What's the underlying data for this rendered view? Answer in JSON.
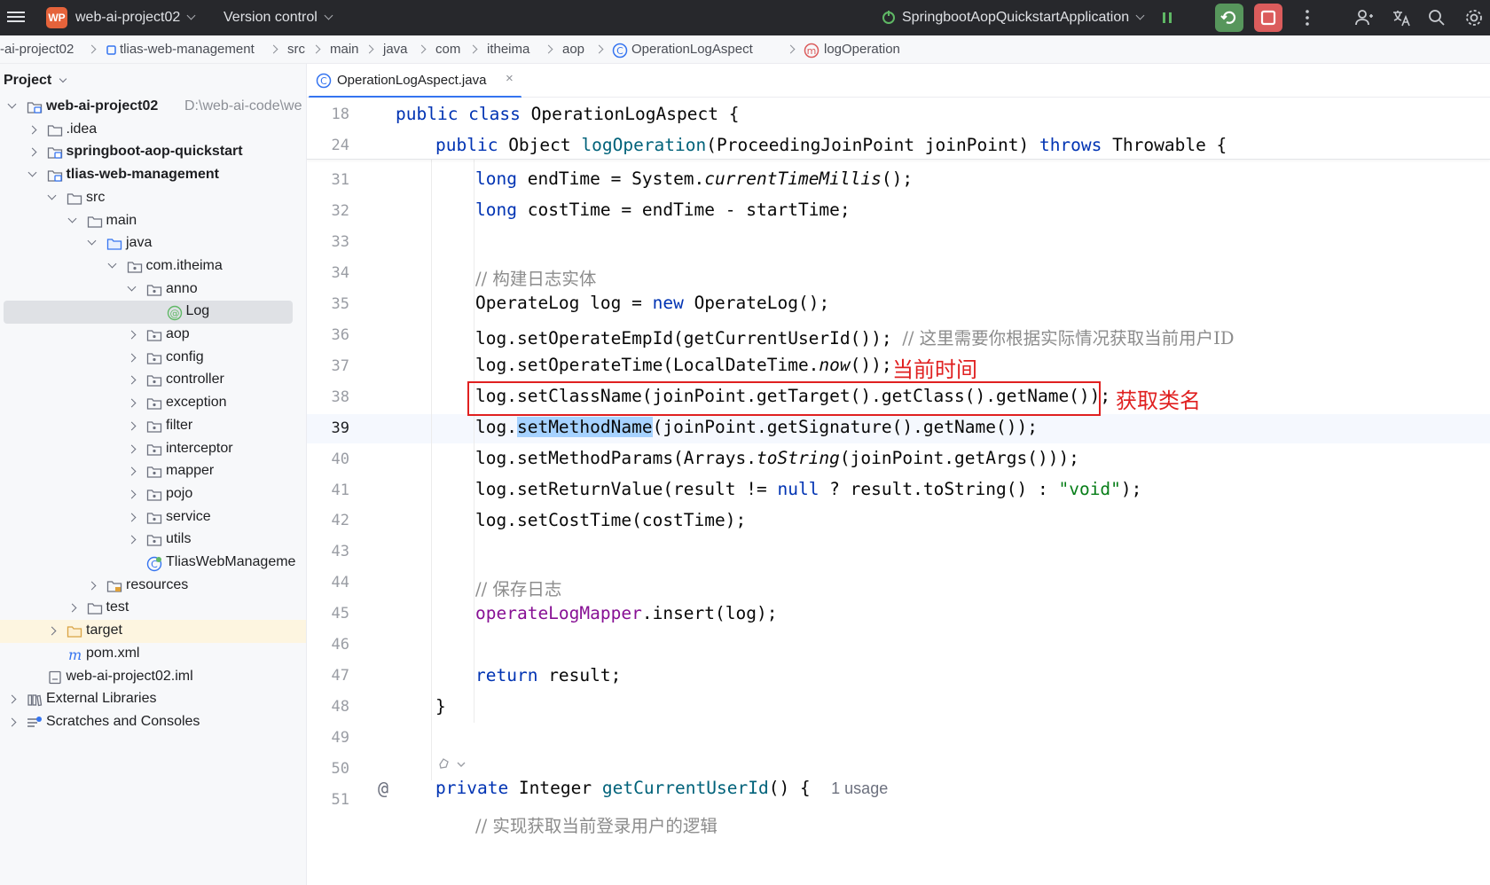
{
  "titlebar": {
    "project_badge": "WP",
    "project_name": "web-ai-project02",
    "vcs_label": "Version control",
    "run_config": "SpringbootAopQuickstartApplication"
  },
  "breadcrumb": [
    "-ai-project02",
    "tlias-web-management",
    "src",
    "main",
    "java",
    "com",
    "itheima",
    "aop",
    "OperationLogAspect",
    "logOperation"
  ],
  "project_panel": {
    "title": "Project",
    "tree": [
      {
        "label": "web-ai-project02",
        "path": "D:\\web-ai-code\\we",
        "bold": true
      },
      {
        "label": ".idea"
      },
      {
        "label": "springboot-aop-quickstart",
        "bold": true
      },
      {
        "label": "tlias-web-management",
        "bold": true
      },
      {
        "label": "src"
      },
      {
        "label": "main"
      },
      {
        "label": "java"
      },
      {
        "label": "com.itheima"
      },
      {
        "label": "anno"
      },
      {
        "label": "Log"
      },
      {
        "label": "aop"
      },
      {
        "label": "config"
      },
      {
        "label": "controller"
      },
      {
        "label": "exception"
      },
      {
        "label": "filter"
      },
      {
        "label": "interceptor"
      },
      {
        "label": "mapper"
      },
      {
        "label": "pojo"
      },
      {
        "label": "service"
      },
      {
        "label": "utils"
      },
      {
        "label": "TliasWebManageme"
      },
      {
        "label": "resources"
      },
      {
        "label": "test"
      },
      {
        "label": "target"
      },
      {
        "label": "pom.xml"
      },
      {
        "label": "web-ai-project02.iml"
      },
      {
        "label": "External Libraries"
      },
      {
        "label": "Scratches and Consoles"
      }
    ]
  },
  "editor": {
    "tab_label": "OperationLogAspect.java",
    "tab_close": "×",
    "sticky_lines": [
      {
        "num": "18",
        "code": "public class OperationLogAspect {"
      },
      {
        "num": "24",
        "code": "public Object logOperation(ProceedingJoinPoint joinPoint) throws Throwable {"
      }
    ],
    "line_numbers": [
      "31",
      "32",
      "33",
      "34",
      "35",
      "36",
      "37",
      "38",
      "39",
      "40",
      "41",
      "42",
      "43",
      "44",
      "45",
      "46",
      "47",
      "48",
      "49",
      "50",
      "51"
    ],
    "code": {
      "l31": "long endTime = System.currentTimeMillis();",
      "l32": "long costTime = endTime - startTime;",
      "l34": "// 构建日志实体",
      "l35": "OperateLog log = new OperateLog();",
      "l36_code": "log.setOperateEmpId(getCurrentUserId()); ",
      "l36_comment": "// 这里需要你根据实际情况获取当前用户ID",
      "l37": "log.setOperateTime(LocalDateTime.now());",
      "l38": "log.setClassName(joinPoint.getTarget().getClass().getName());",
      "l39_pre": "log.",
      "l39_sel": "setMethodName",
      "l39_post": "(joinPoint.getSignature().getName());",
      "l40": "log.setMethodParams(Arrays.toString(joinPoint.getArgs()));",
      "l41_pre": "log.setReturnValue(result != ",
      "l41_null": "null",
      "l41_mid": " ? result.toString() : ",
      "l41_str": "\"void\"",
      "l41_end": ");",
      "l42": "log.setCostTime(costTime);",
      "l44": "// 保存日志",
      "l45_field": "operateLogMapper",
      "l45_rest": ".insert(log);",
      "l47_kw": "return",
      "l47_rest": " result;",
      "l48": "}",
      "l50_kw": "private",
      "l50_type": " Integer ",
      "l50_fn": "getCurrentUserId",
      "l50_rest": "() {",
      "l50_usage": "1 usage",
      "l51": "// 实现获取当前登录用户的逻辑",
      "gutter_at": "@"
    }
  },
  "annotations": {
    "note_time": "当前时间",
    "note_classname": "获取类名",
    "color": "#e02020"
  }
}
